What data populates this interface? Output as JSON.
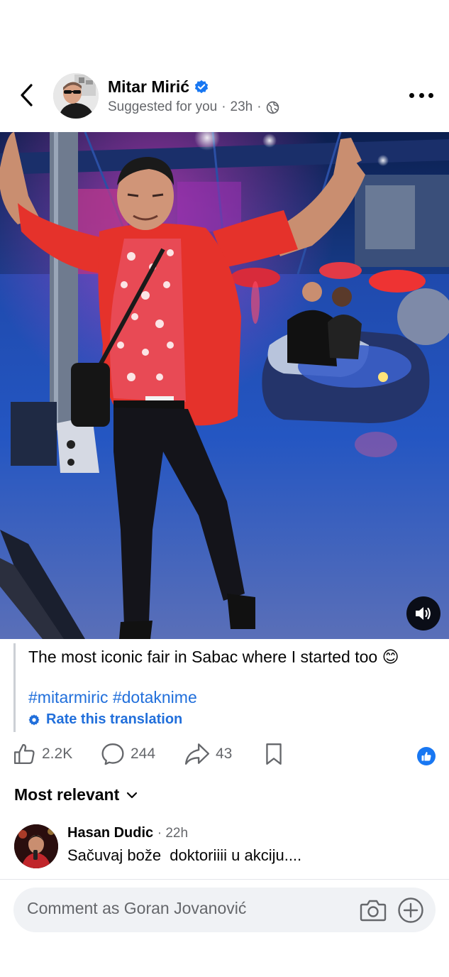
{
  "post": {
    "author": "Mitar Mirić",
    "suggested_label": "Suggested for you",
    "time": "23h",
    "separator": "·",
    "caption": "The most iconic fair in Sabac where I started too 😊",
    "hashtags": "#mitarmiric #dotaknime",
    "rate_translation": "Rate this translation"
  },
  "icons": {
    "back": "chevron-left-icon",
    "verified": "verified-badge-icon",
    "globe": "globe-icon",
    "more": "more-horizontal-icon",
    "volume": "volume-on-icon",
    "settings": "gear-icon",
    "like": "thumbs-up-icon",
    "comment": "comment-bubble-icon",
    "share": "share-arrow-icon",
    "save": "bookmark-icon",
    "camera": "camera-icon",
    "add": "plus-circle-icon"
  },
  "stats": {
    "likes": "2.2K",
    "comments": "244",
    "shares": "43"
  },
  "comments_section": {
    "sort_label": "Most relevant",
    "items": [
      {
        "name": "Hasan Dudic",
        "time": "22h",
        "text": "Sačuvaj bože  doktoriiii u akciju...."
      }
    ]
  },
  "composer": {
    "placeholder": "Comment as Goran Jovanović"
  },
  "colors": {
    "accent_blue": "#216fdb",
    "brand_blue": "#1877f2",
    "secondary_text": "#65676b",
    "composer_bg": "#f0f2f5",
    "shirt_red": "#e5322b"
  }
}
